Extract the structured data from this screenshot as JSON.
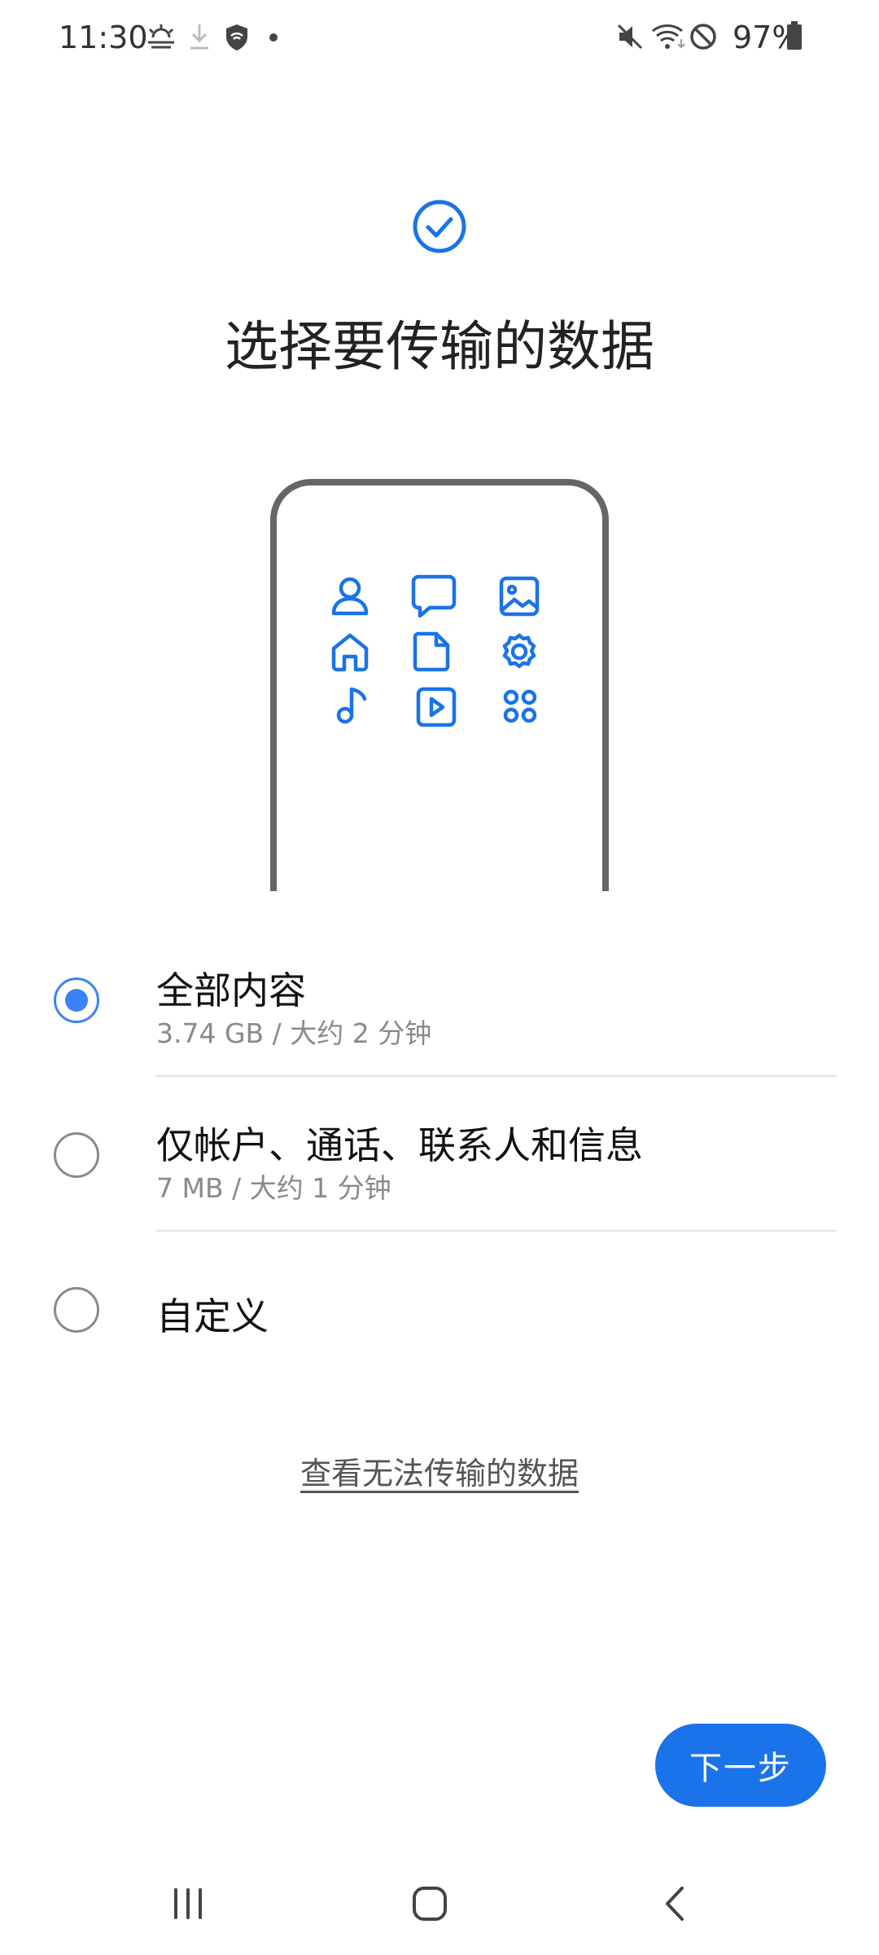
{
  "status_bar": {
    "time": "11:30",
    "battery": "97%",
    "left_icons": [
      "weather-icon",
      "download-icon",
      "vpn-shield-icon",
      "dot-icon"
    ],
    "right_icons": [
      "mute-icon",
      "wifi-icon",
      "no-disturb-icon",
      "battery-icon"
    ]
  },
  "header": {
    "title": "选择要传输的数据",
    "icon": "check-circle-icon",
    "accent_color": "#1a73e8"
  },
  "illustration": {
    "icons": [
      "person-icon",
      "message-icon",
      "image-icon",
      "home-icon",
      "document-icon",
      "settings-icon",
      "music-icon",
      "video-icon",
      "apps-icon"
    ]
  },
  "options": [
    {
      "label": "全部内容",
      "sub": "3.74 GB / 大约 2 分钟",
      "selected": true
    },
    {
      "label": "仅帐户、通话、联系人和信息",
      "sub": "7 MB / 大约 1 分钟",
      "selected": false
    },
    {
      "label": "自定义",
      "selected": false
    }
  ],
  "link": "查看无法传输的数据",
  "next_button": "下一步",
  "nav_bar": {
    "icons": [
      "recents-icon",
      "home-icon",
      "back-icon"
    ]
  }
}
